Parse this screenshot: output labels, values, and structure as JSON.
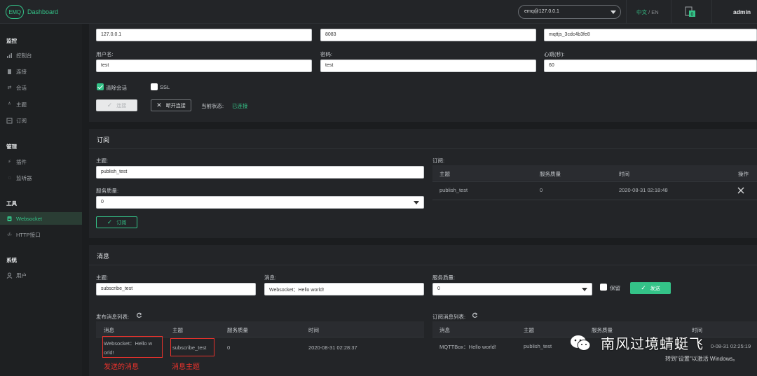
{
  "header": {
    "logo_badge": "EMQ",
    "title": "Dashboard",
    "node": "emq@127.0.0.1",
    "lang_zh": "中文",
    "lang_sep": "/",
    "lang_en": "EN",
    "alarm_count": "0",
    "user": "admin"
  },
  "sidebar": {
    "groups": [
      {
        "title": "监控",
        "items": [
          {
            "label": "控制台",
            "icon": "dashboard-icon"
          },
          {
            "label": "连接",
            "icon": "connections-icon"
          },
          {
            "label": "会话",
            "icon": "sessions-icon"
          },
          {
            "label": "主题",
            "icon": "topics-icon"
          },
          {
            "label": "订阅",
            "icon": "subscriptions-icon"
          }
        ]
      },
      {
        "title": "管理",
        "items": [
          {
            "label": "插件",
            "icon": "plugins-icon"
          },
          {
            "label": "监听器",
            "icon": "listeners-icon"
          }
        ]
      },
      {
        "title": "工具",
        "items": [
          {
            "label": "Websocket",
            "icon": "websocket-icon",
            "active": true
          },
          {
            "label": "HTTP接口",
            "icon": "code-icon"
          }
        ]
      },
      {
        "title": "系统",
        "items": [
          {
            "label": "用户",
            "icon": "user-icon"
          }
        ]
      }
    ]
  },
  "connection": {
    "host_value": "127.0.0.1",
    "port_value": "8083",
    "client_id_value": "mqttjs_3cdc4b3fe8",
    "username_label": "用户名:",
    "username_value": "test",
    "password_label": "密码:",
    "password_value": "test",
    "keepalive_label": "心跳(秒):",
    "keepalive_value": "60",
    "clean_session_label": "清除会话",
    "ssl_label": "SSL",
    "connect_label": "连接",
    "disconnect_label": "断开连接",
    "status_label": "当前状态:",
    "status_value": "已连接"
  },
  "subscribe": {
    "title": "订阅",
    "topic_label": "主题:",
    "topic_value": "publish_test",
    "qos_label": "服务质量:",
    "qos_value": "0",
    "button_label": "订阅",
    "list_label": "订阅:",
    "columns": [
      "主题",
      "服务质量",
      "时间",
      "操作"
    ],
    "rows": [
      {
        "topic": "publish_test",
        "qos": "0",
        "time": "2020-08-31 02:18:48"
      }
    ]
  },
  "message": {
    "title": "消息",
    "topic_label": "主题:",
    "topic_value": "subscribe_test",
    "payload_label": "消息:",
    "payload_value": "Websocket：Hello world!",
    "qos_label": "服务质量:",
    "qos_value": "0",
    "retain_label": "保留",
    "send_label": "发送",
    "published_list_label": "发布消息列表:",
    "received_list_label": "订阅消息列表:",
    "published_columns": [
      "消息",
      "主题",
      "服务质量",
      "时间"
    ],
    "published_rows": [
      {
        "message_line1": "Websocket：Hello w",
        "message_line2": "orld!",
        "topic": "subscribe_test",
        "qos": "0",
        "time": "2020-08-31 02:28:37"
      }
    ],
    "received_columns": [
      "消息",
      "主题",
      "服务质量",
      "时间"
    ],
    "received_rows": [
      {
        "message": "MQTTBox：Hello world!",
        "topic": "publish_test",
        "time_partial": "0-08-31 02:25:19"
      }
    ]
  },
  "annotations": {
    "sent_message": "发送的消息",
    "message_topic": "消息主题"
  },
  "watermark": {
    "text": "南风过境蜻蜓飞",
    "windows_notice": "转到\"设置\"以激活 Windows。"
  },
  "colors": {
    "accent": "#34c388",
    "annotation_red": "#e8322c"
  }
}
